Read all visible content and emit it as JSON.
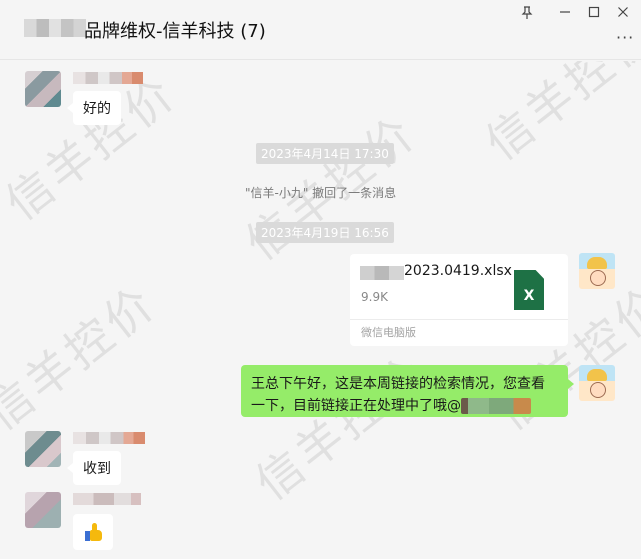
{
  "window": {
    "title": "品牌维权-信羊科技 (7)",
    "controls": {
      "pin_icon": "pin-icon",
      "minimize_icon": "minimize-icon",
      "maximize_icon": "maximize-icon",
      "close_icon": "close-icon"
    },
    "more_label": "···"
  },
  "messages": {
    "m1_text": "好的",
    "time1": "2023年4月14日 17:30",
    "recall_notice": "\"信羊-小九\" 撤回了一条消息",
    "time2": "2023年4月19日 16:56",
    "file": {
      "name_visible": "2023.0419.xlsx",
      "size": "9.9K",
      "source": "微信电脑版",
      "icon": "excel-icon",
      "icon_letter": "X"
    },
    "m2_text": "王总下午好，这是本周链接的检索情况，您查看一下，目前链接正在处理中了哦@",
    "m3_text": "收到",
    "m4_emoji": "thumbs-up-icon"
  },
  "watermark": "信羊控价",
  "colors": {
    "out_bubble": "#95ec69",
    "in_bubble": "#ffffff",
    "background": "#f5f5f5",
    "excel": "#1e7145"
  }
}
